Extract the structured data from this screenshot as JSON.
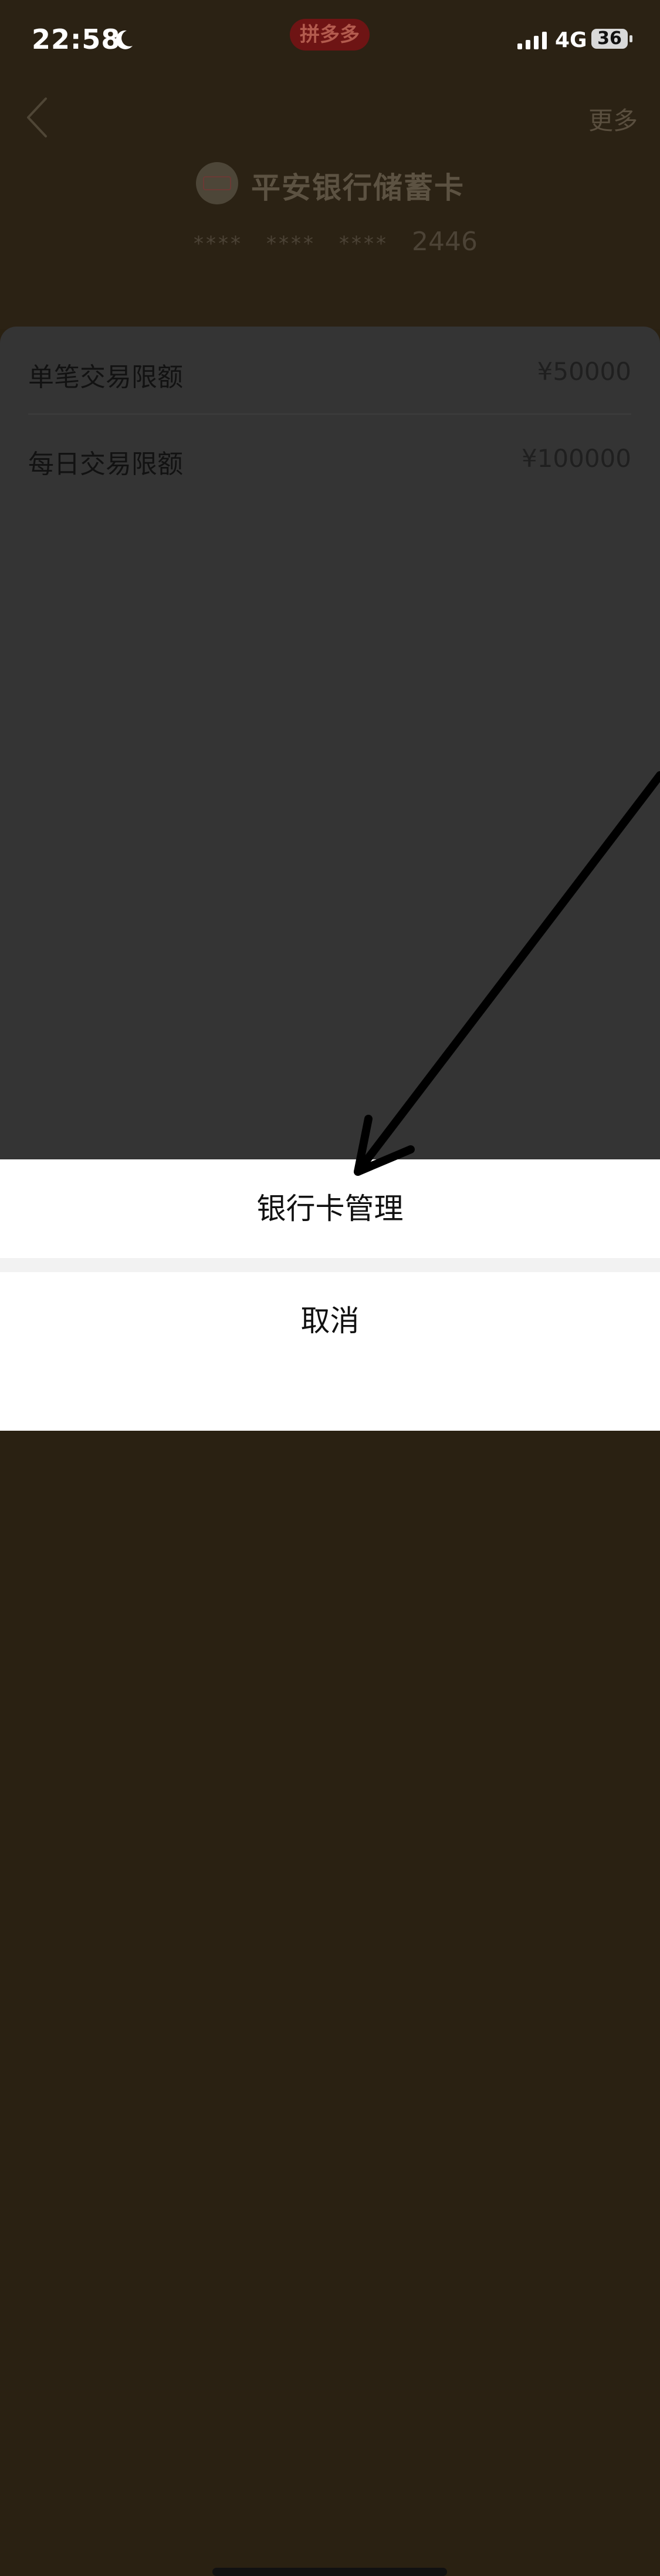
{
  "status_bar": {
    "time": "22:58",
    "network": "4G",
    "battery": "36",
    "center_badge": "拼多多"
  },
  "nav": {
    "more_label": "更多"
  },
  "card": {
    "bank_name": "平安银行储蓄卡",
    "mask_groups": [
      "****",
      "****",
      "****"
    ],
    "last4": "2446"
  },
  "limits": [
    {
      "label": "单笔交易限额",
      "value": "¥50000"
    },
    {
      "label": "每日交易限额",
      "value": "¥100000"
    }
  ],
  "action_sheet": {
    "primary": "银行卡管理",
    "cancel": "取消"
  },
  "colors": {
    "header_bg": "#2b2214",
    "panel_bg": "#343434",
    "sheet_bg": "#ffffff",
    "pdd_red": "#6e1414"
  },
  "icons": {
    "back": "chevron-left-icon",
    "moon": "moon-icon",
    "signal": "cellular-signal-icon",
    "battery": "battery-icon",
    "bank_logo": "bank-logo-icon"
  }
}
